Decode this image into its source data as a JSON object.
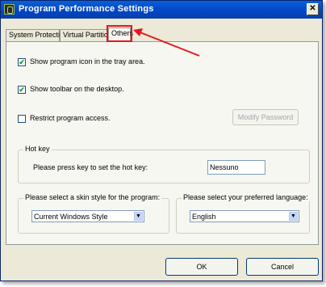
{
  "window": {
    "title": "Program Performance Settings",
    "close_symbol": "✕"
  },
  "tabs": [
    {
      "label": "System Protection",
      "active": false
    },
    {
      "label": "Virtual Partition",
      "active": false
    },
    {
      "label": "Others",
      "active": true
    }
  ],
  "options": {
    "show_tray_icon": {
      "label": "Show program icon in the tray area.",
      "checked": true
    },
    "show_toolbar": {
      "label": "Show toolbar on the desktop.",
      "checked": true
    },
    "restrict_access": {
      "label": "Restrict program access.",
      "checked": false
    }
  },
  "modify_password_label": "Modify Password",
  "hotkey": {
    "group_label": "Hot key",
    "prompt": "Please press key to set the hot key:",
    "value": "Nessuno"
  },
  "skin": {
    "label": "Please select a skin style for the program:",
    "selected": "Current Windows Style"
  },
  "language": {
    "label": "Please select your preferred language:",
    "selected": "English"
  },
  "buttons": {
    "ok": "OK",
    "cancel": "Cancel"
  },
  "colors": {
    "titlebar": "#0046c4",
    "annotation": "#e8141c",
    "checkmark": "#21a121"
  },
  "icons": {
    "app": "app-icon",
    "close": "close-icon",
    "dropdown": "chevron-down-icon",
    "check": "check-icon"
  }
}
